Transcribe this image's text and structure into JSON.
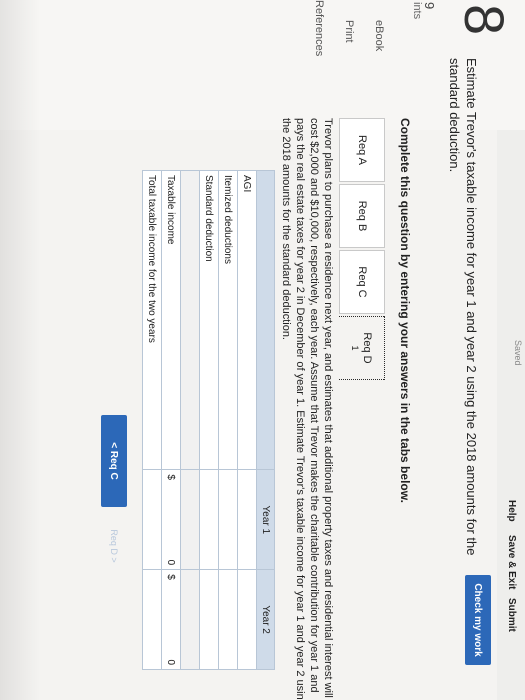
{
  "topbar": {
    "saved": "Saved",
    "help": "Help",
    "save_exit": "Save & Exit",
    "submit": "Submit"
  },
  "check_button": "Check my work",
  "question_number": "8",
  "points": {
    "value": "9",
    "label": "ints"
  },
  "side_links": {
    "ebook": "eBook",
    "print": "Print",
    "references": "References"
  },
  "question_text": "Estimate Trevor's taxable income for year 1 and year 2 using the 2018 amounts for the standard deduction.",
  "instruction": "Complete this question by entering your answers in the tabs below.",
  "tabs": [
    {
      "label": "Req A"
    },
    {
      "label": "Req B"
    },
    {
      "label": "Req C"
    },
    {
      "label": "Req D",
      "sub": "1"
    }
  ],
  "scenario": "Trevor plans to purchase a residence next year, and estimates that additional property taxes and residential interest will cost $2,000 and $10,000, respectively, each year. Assume that Trevor makes the charitable contribution for year 1 and pays the real estate taxes for year 2 in December of year 1. Estimate Trevor's taxable income for year 1 and year 2 using the 2018 amounts for the standard deduction.",
  "table": {
    "headers": [
      "",
      "Year 1",
      "Year 2"
    ],
    "rows": [
      {
        "label": "AGI",
        "year1": "",
        "year2": ""
      },
      {
        "label": "Itemized deductions",
        "year1": "",
        "year2": ""
      },
      {
        "label": "Standard deduction",
        "year1": "",
        "year2": ""
      },
      {
        "label": "",
        "year1": "",
        "year2": ""
      },
      {
        "label": "Taxable income",
        "year1": "0",
        "year2": "0",
        "currency": "$"
      },
      {
        "label": "Total taxable income for the two years",
        "year1": "",
        "year2": ""
      }
    ]
  },
  "nav": {
    "prev": "< Req C",
    "next": "Req D >"
  }
}
